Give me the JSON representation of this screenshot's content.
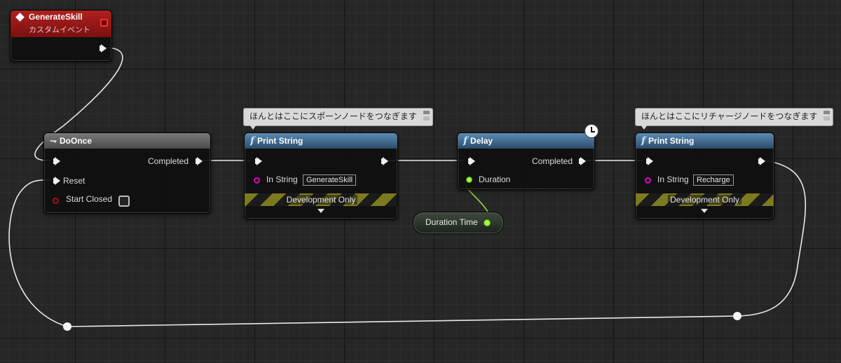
{
  "event_node": {
    "title": "GenerateSkill",
    "subtitle": "カスタムイベント"
  },
  "doonce_node": {
    "title": "DoOnce",
    "completed": "Completed",
    "reset": "Reset",
    "start_closed": "Start Closed"
  },
  "print1_node": {
    "title": "Print String",
    "in_string_label": "In String",
    "in_string_value": "GenerateSkill",
    "dev_only": "Development Only"
  },
  "delay_node": {
    "title": "Delay",
    "completed": "Completed",
    "duration": "Duration"
  },
  "var_node": {
    "name": "Duration Time"
  },
  "print2_node": {
    "title": "Print String",
    "in_string_label": "In String",
    "in_string_value": "Recharge",
    "dev_only": "Development Only"
  },
  "comments": [
    {
      "text": "ほんとはここにスポーンノードをつなぎます"
    },
    {
      "text": "ほんとはここにリチャージノードをつなぎます"
    }
  ],
  "colors": {
    "event_header": "#8a1414",
    "function_header": "#2b4c6b",
    "macro_header": "#4a4a4a",
    "string_pin": "#e000c8",
    "bool_pin": "#8c0000",
    "float_pin": "#9bff3a",
    "exec_wire": "#e8e8e8"
  },
  "icons": [
    "event-diamond-icon",
    "delegate-square-icon",
    "macro-arrow-icon",
    "function-f-icon",
    "clock-icon",
    "comment-bubble-icon"
  ]
}
